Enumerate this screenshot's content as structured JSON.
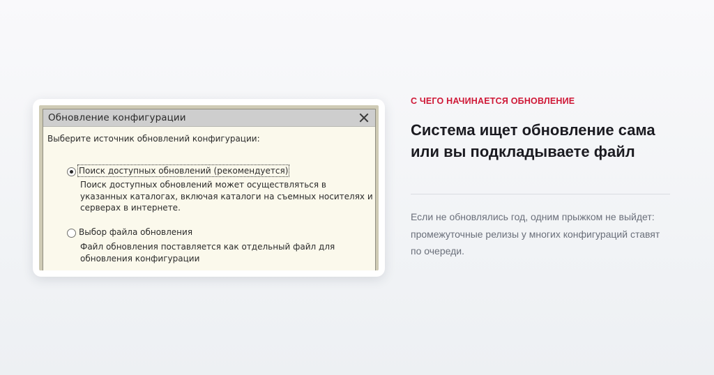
{
  "dialog": {
    "title": "Обновление конфигурации",
    "close_icon": "close-icon",
    "prompt": "Выберите источник обновлений конфигурации:",
    "options": [
      {
        "label": "Поиск доступных обновлений (рекомендуется)",
        "selected": true,
        "description": "Поиск доступных обновлений может осуществляться в\nуказанных каталогах, включая каталоги на съемных носителях и\nсерверах в интернете."
      },
      {
        "label": "Выбор файла обновления",
        "selected": false,
        "description": "Файл обновления поставляется как отдельный файл для\nобновления конфигурации"
      }
    ]
  },
  "article": {
    "eyebrow": "С ЧЕГО НАЧИНАЕТСЯ ОБНОВЛЕНИЕ",
    "headline": "Система ищет обновление сама или вы подкладываете файл",
    "body": "Если не обновлялись год, одним прыжком не выйдет: промежуточные релизы у многих конфигураций ставят по очереди."
  },
  "colors": {
    "accent": "#cf1736",
    "headline": "#1b1b21",
    "body_text": "#6a6f7a",
    "dialog_bg": "#fbf9ec",
    "dialog_title_bar": "#cecece"
  }
}
